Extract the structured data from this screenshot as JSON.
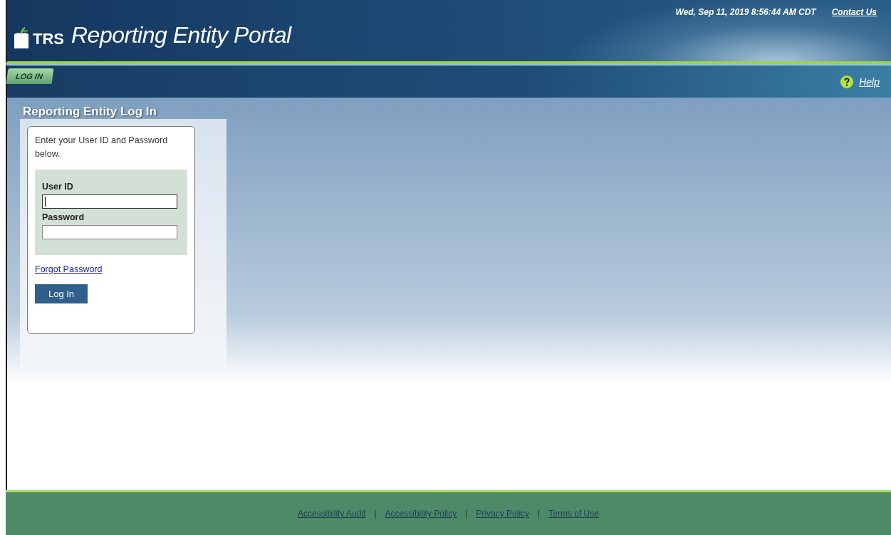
{
  "header": {
    "logo_text": "TRS",
    "title": "Reporting Entity Portal",
    "datetime": "Wed, Sep 11, 2019 8:56:44 AM CDT",
    "contact_link": "Contact Us"
  },
  "nav": {
    "tabs": [
      {
        "label": "LOG IN",
        "selected": true
      }
    ],
    "help_link": "Help"
  },
  "login": {
    "heading": "Reporting Entity Log In",
    "instructions": "Enter your User ID and Password below.",
    "fields": [
      {
        "label": "User ID",
        "focused": true
      },
      {
        "label": "Password",
        "focused": false
      }
    ],
    "forgot_link": "Forgot Password",
    "submit": "Log In"
  },
  "footer": {
    "separator": "|",
    "links": [
      "Accessibility Audit",
      "Accessibility Policy",
      "Privacy Policy",
      "Terms of Use"
    ]
  }
}
